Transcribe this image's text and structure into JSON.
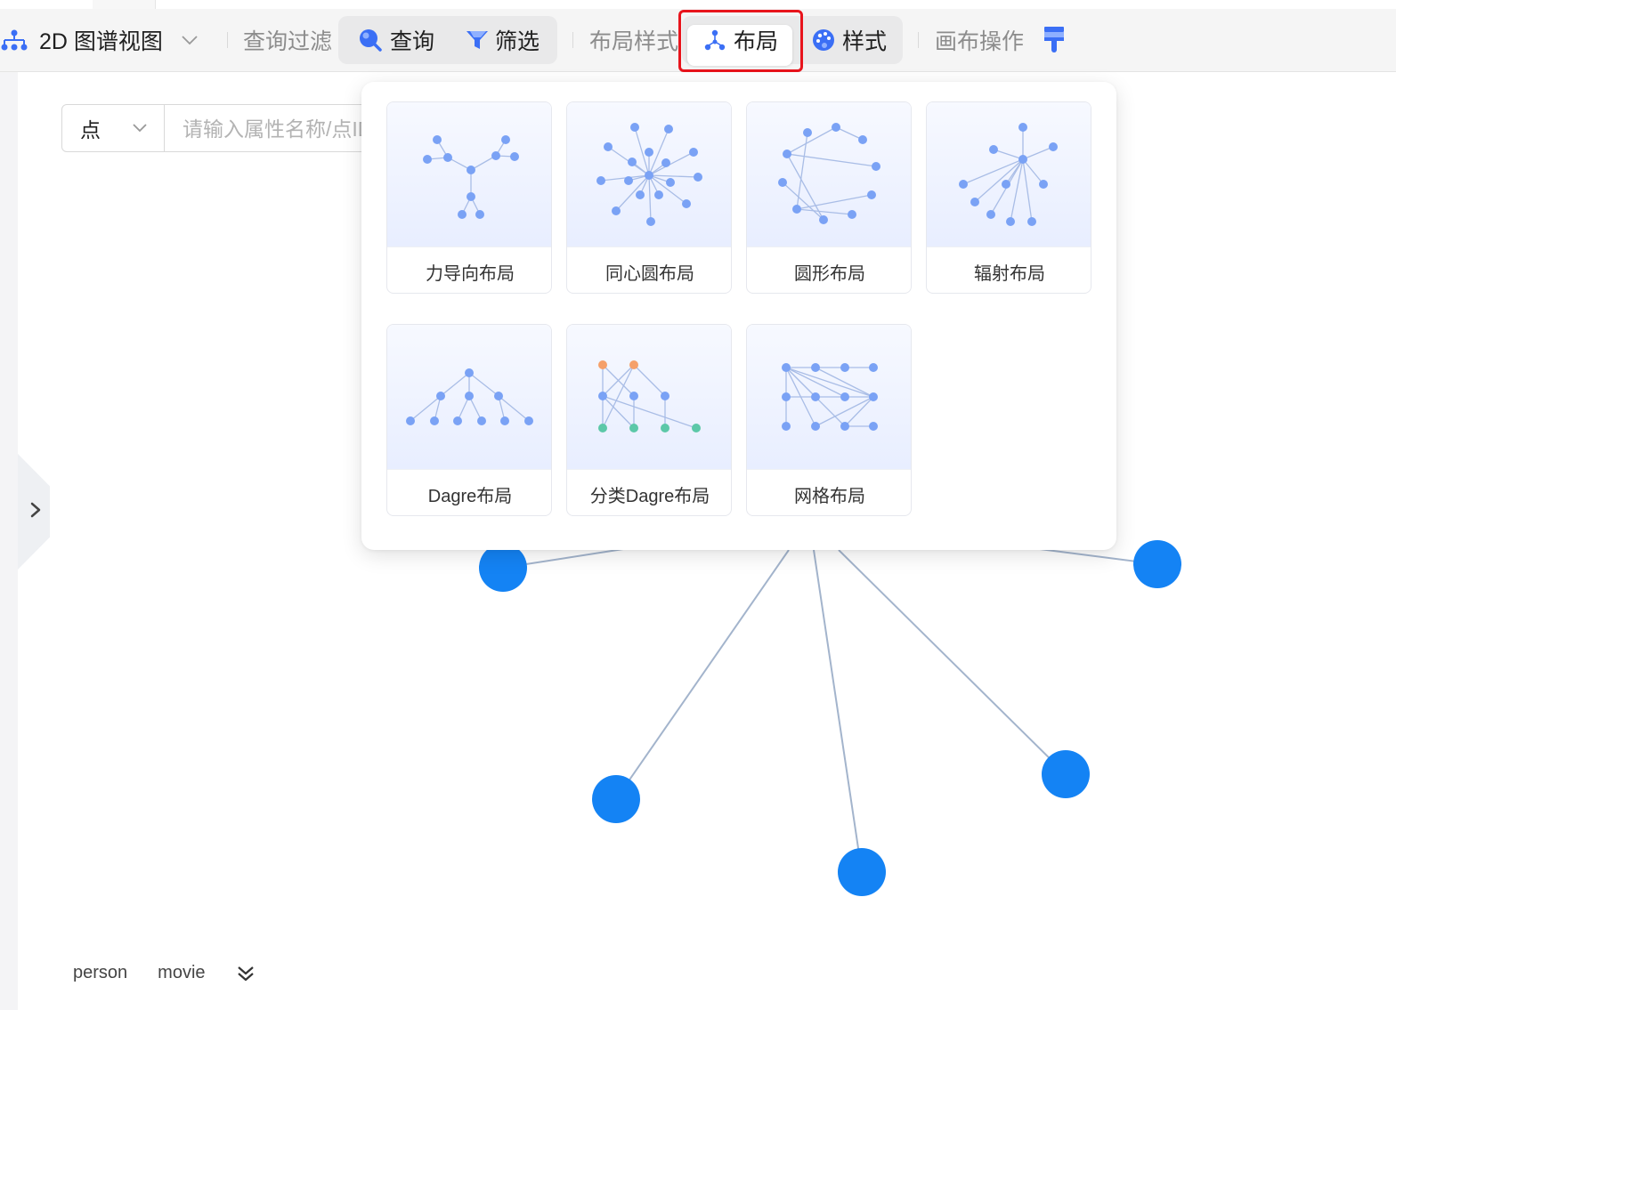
{
  "toolbar": {
    "view_label": "2D 图谱视图",
    "query_filter_label": "查询过滤",
    "query_label": "查询",
    "filter_label": "筛选",
    "layout_style_label": "布局样式",
    "layout_label": "布局",
    "style_label": "样式",
    "canvas_ops_label": "画布操作"
  },
  "search": {
    "type_value": "点",
    "placeholder": "请输入属性名称/点ID"
  },
  "layout_menu": {
    "items": [
      {
        "label": "力导向布局"
      },
      {
        "label": "同心圆布局"
      },
      {
        "label": "圆形布局"
      },
      {
        "label": "辐射布局"
      },
      {
        "label": "Dagre布局"
      },
      {
        "label": "分类Dagre布局"
      },
      {
        "label": "网格布局"
      }
    ]
  },
  "legend": {
    "items": [
      "person",
      "movie"
    ]
  },
  "colors": {
    "node": "#1483f4",
    "edge": "#a3b4cc",
    "highlight": "#e8141c",
    "accent": "#3b6ff5",
    "thumb_node": "#7aa2f5",
    "thumb_orange": "#f5a06a",
    "thumb_green": "#5cc8a8"
  }
}
